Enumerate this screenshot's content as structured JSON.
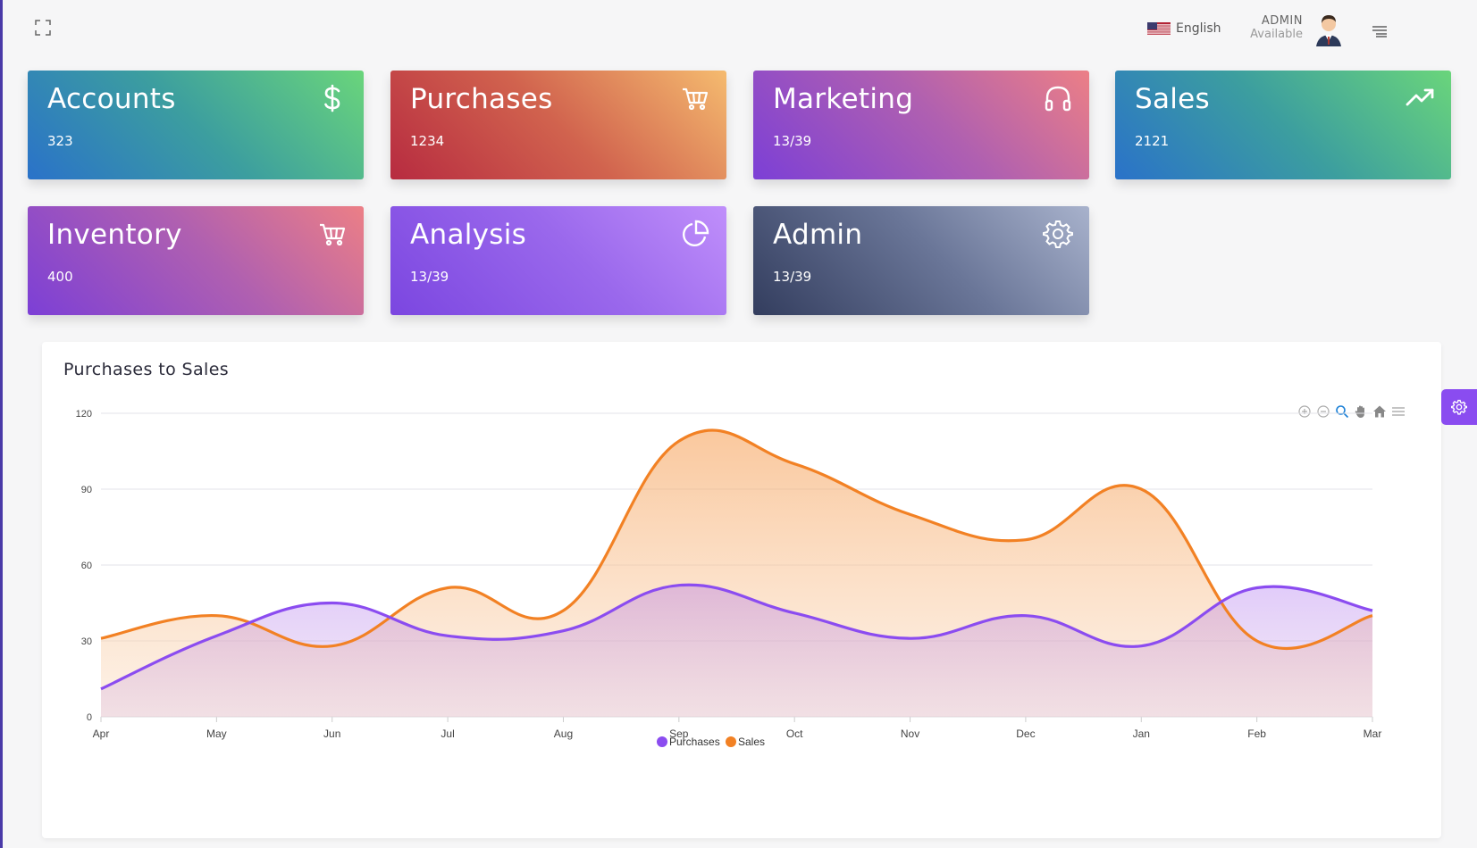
{
  "header": {
    "language": "English",
    "user_name": "ADMIN",
    "user_status": "Available"
  },
  "cards": [
    {
      "id": "accounts",
      "title": "Accounts",
      "value": "323",
      "icon": "dollar-icon"
    },
    {
      "id": "purchases",
      "title": "Purchases",
      "value": "1234",
      "icon": "cart-icon"
    },
    {
      "id": "marketing",
      "title": "Marketing",
      "value": "13/39",
      "icon": "headphones-icon"
    },
    {
      "id": "sales",
      "title": "Sales",
      "value": "2121",
      "icon": "trending-up-icon"
    },
    {
      "id": "inventory",
      "title": "Inventory",
      "value": "400",
      "icon": "cart-icon"
    },
    {
      "id": "analysis",
      "title": "Analysis",
      "value": "13/39",
      "icon": "pie-chart-icon"
    },
    {
      "id": "admin",
      "title": "Admin",
      "value": "13/39",
      "icon": "gear-icon"
    }
  ],
  "panel": {
    "title": "Purchases to Sales"
  },
  "colors": {
    "purchases": "#8b4cf0",
    "sales": "#f28124"
  },
  "chart_data": {
    "type": "area",
    "categories": [
      "Apr",
      "May",
      "Jun",
      "Jul",
      "Aug",
      "Sep",
      "Oct",
      "Nov",
      "Dec",
      "Jan",
      "Feb",
      "Mar"
    ],
    "series": [
      {
        "name": "Purchases",
        "values": [
          11,
          32,
          45,
          32,
          34,
          52,
          41,
          31,
          40,
          28,
          51,
          42
        ]
      },
      {
        "name": "Sales",
        "values": [
          31,
          40,
          28,
          51,
          42,
          109,
          100,
          80,
          70,
          90,
          30,
          40
        ]
      }
    ],
    "yticks": [
      0,
      30,
      60,
      90,
      120
    ],
    "ylim": [
      0,
      120
    ],
    "grid": true,
    "legend_position": "bottom-center"
  }
}
